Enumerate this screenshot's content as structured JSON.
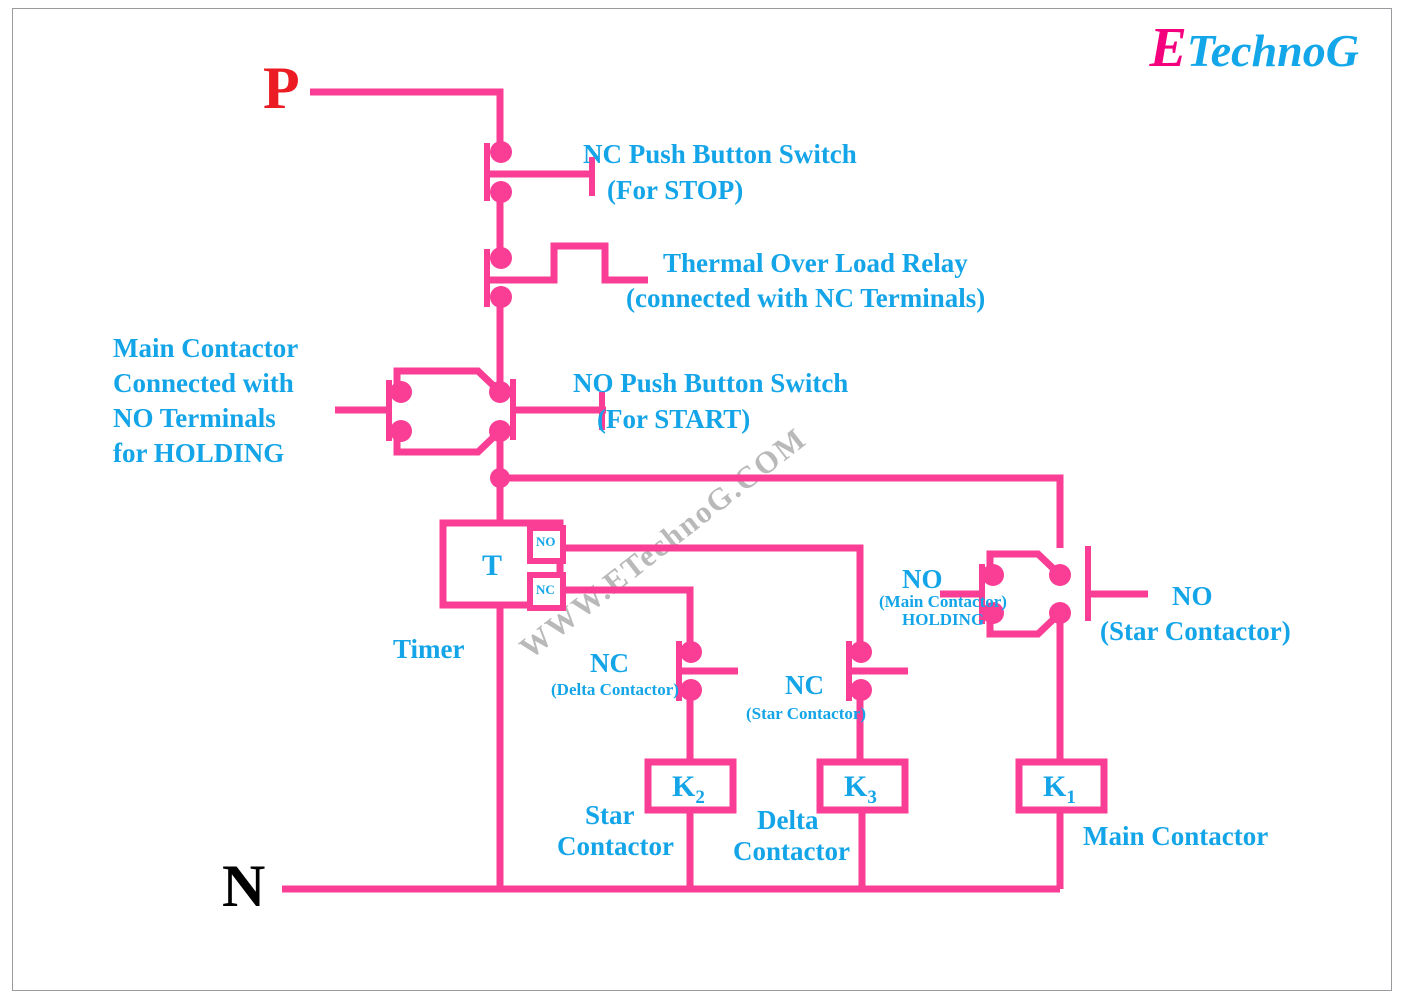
{
  "brand": {
    "logo_first": "E",
    "logo_rest": "TechnoG"
  },
  "watermark": "WWW.ETechnoG.COM",
  "rails": {
    "phase": "P",
    "neutral": "N"
  },
  "annotations": {
    "nc_push_line1": "NC Push Button Switch",
    "nc_push_line2": "(For STOP)",
    "thermal_line1": "Thermal Over Load Relay",
    "thermal_line2": "(connected with NC Terminals)",
    "main_hold_line1": "Main Contactor",
    "main_hold_line2": "Connected with",
    "main_hold_line3": "NO Terminals",
    "main_hold_line4": "for HOLDING",
    "no_push_line1": "NO Push Button Switch",
    "no_push_line2": "(For START)",
    "timer_label": "Timer",
    "timer_box": "T",
    "timer_no_terminal": "NO",
    "timer_nc_terminal": "NC",
    "nc_delta_line1": "NC",
    "nc_delta_line2": "(Delta Contactor)",
    "nc_star_line1": "NC",
    "nc_star_line2": "(Star Contactor)",
    "no_main_hold_line1": "NO",
    "no_main_hold_line2": "(Main Contactor)",
    "no_main_hold_line3": "HOLDING",
    "no_star_line1": "NO",
    "no_star_line2": "(Star Contactor)",
    "star_contactor_line1": "Star",
    "star_contactor_line2": "Contactor",
    "delta_contactor_line1": "Delta",
    "delta_contactor_line2": "Contactor",
    "main_contactor": "Main Contactor"
  },
  "coils": [
    {
      "name": "K",
      "sub": "2",
      "role": "star-contactor"
    },
    {
      "name": "K",
      "sub": "3",
      "role": "delta-contactor"
    },
    {
      "name": "K",
      "sub": "1",
      "role": "main-contactor"
    }
  ],
  "colors": {
    "wire": "#fa3d95",
    "label": "#14a5e8",
    "phase": "#ec1c24",
    "neutral": "#000000",
    "brand_pink": "#f4007f",
    "brand_blue": "#13a7ea",
    "watermark": "#b9b9b9",
    "border": "#9a9a9e"
  }
}
